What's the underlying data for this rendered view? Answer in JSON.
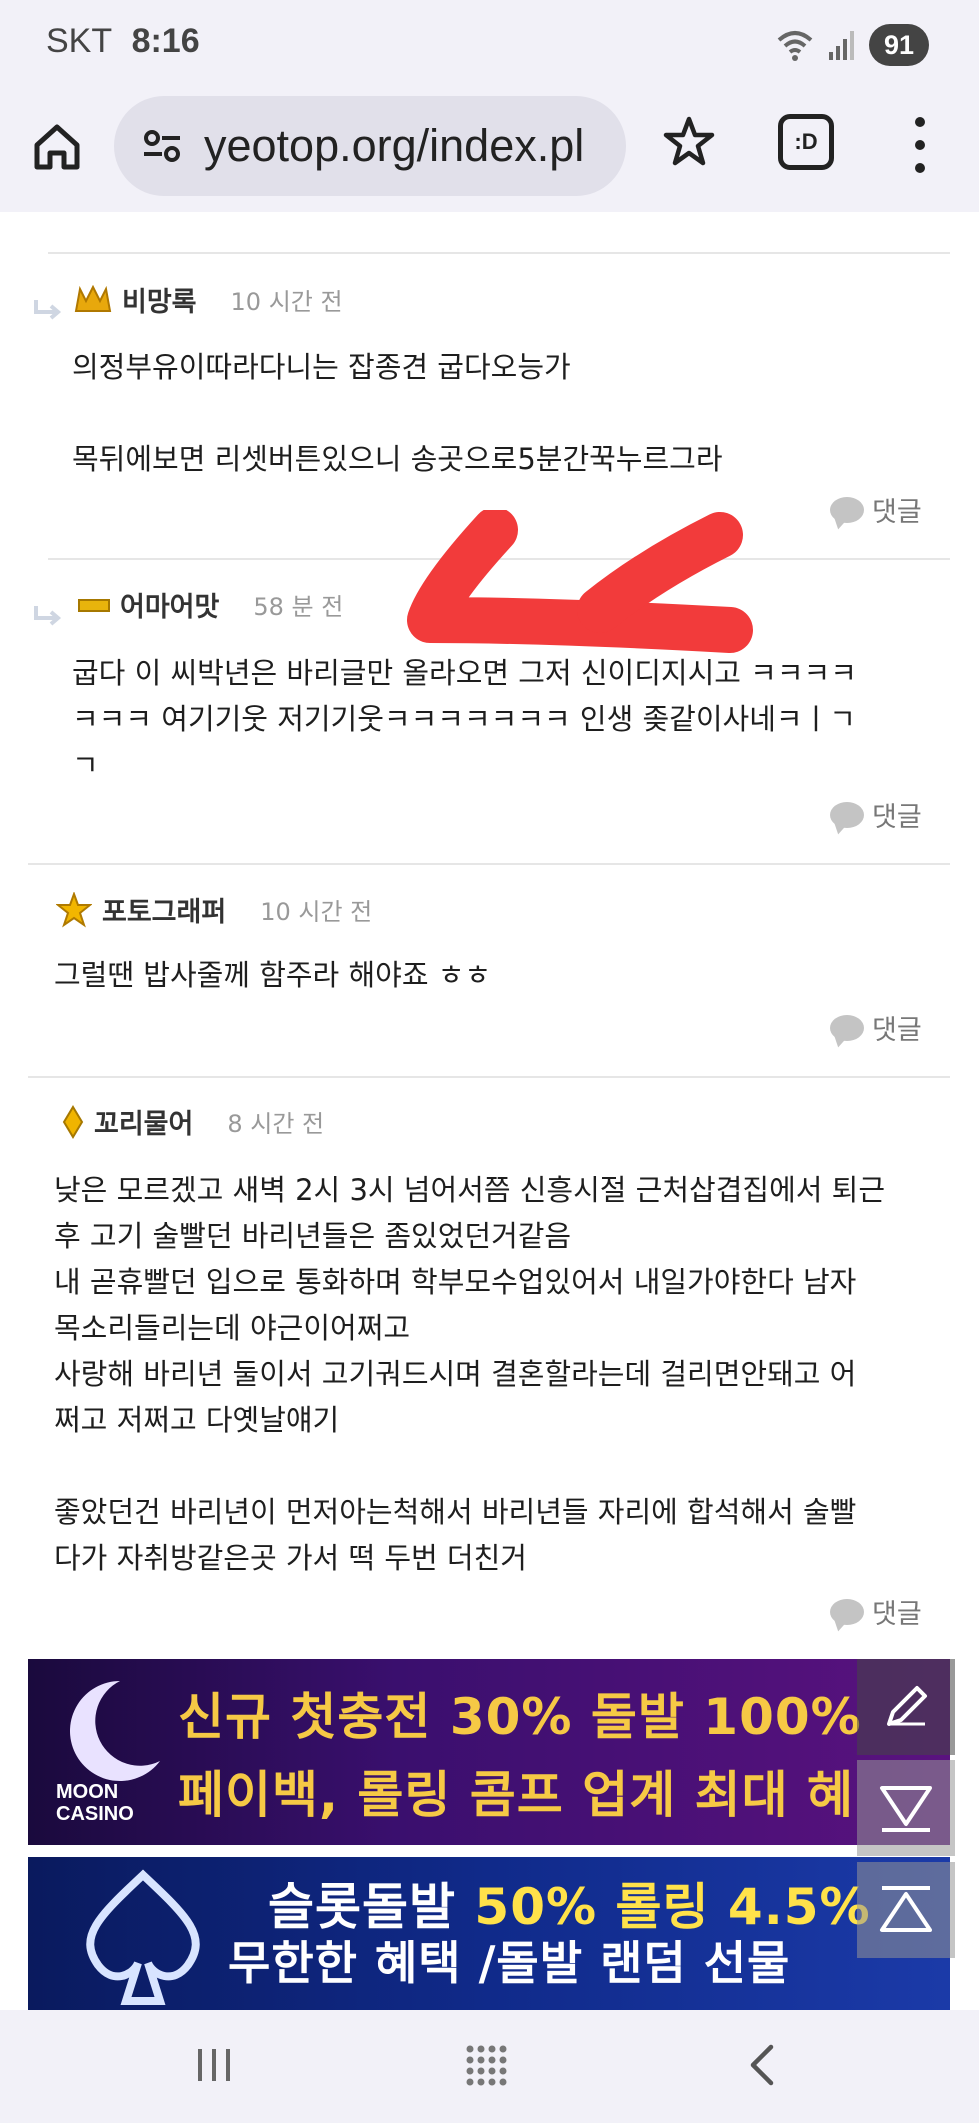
{
  "status_bar": {
    "carrier": "SKT",
    "time": "8:16",
    "battery": "91"
  },
  "browser": {
    "url": "yeotop.org/index.pl",
    "extension_label": ":D"
  },
  "colors": {
    "annotation_arrow": "#f23b3b",
    "banner_gold": "#f6c945",
    "banner_yellow": "#ffe24a"
  },
  "comments": [
    {
      "author": "비망록",
      "time": "10 시간 전",
      "body": "의정부유이따라다니는 잡종견 굽다오능가\n\n목뒤에보면 리셋버튼있으니 송곳으로5분간꾹누르그라",
      "reply_label": "댓글",
      "badge_icon": "crown-gold-icon"
    },
    {
      "author": "어마어맛",
      "time": "58 분 전",
      "body": "굽다 이 씨박년은 바리글만 올라오면 그저 신이디지시고 ㅋㅋㅋㅋ\nㅋㅋㅋ 여기기웃 저기기웃ㅋㅋㅋㅋㅋㅋㅋ 인생 좆같이사네ㅋㅣㄱ\nㄱ",
      "reply_label": "댓글",
      "badge_icon": "gold-bar-icon"
    },
    {
      "author": "포토그래퍼",
      "time": "10 시간 전",
      "body": "그럴땐 밥사줄께 함주라 해야죠 ㅎㅎ",
      "reply_label": "댓글",
      "badge_icon": "gold-star-icon"
    },
    {
      "author": "꼬리물어",
      "time": "8 시간 전",
      "body": "낮은 모르겠고 새벽 2시 3시 넘어서쯤 신흥시절 근처삽겹집에서 퇴근\n후 고기 술빨던 바리년들은 좀있었던거같음\n내 곧휴빨던 입으로 통화하며 학부모수업있어서 내일가야한다 남자\n목소리들리는데 야근이어쩌고\n사랑해 바리년 둘이서 고기궈드시며 결혼할라는데 걸리면안돼고 어\n쩌고 저쩌고 다옛날얘기\n\n좋았던건 바리년이 먼저아는척해서 바리년들 자리에 합석해서 술빨\n다가 자취방같은곳 가서 떡 두번 더친거",
      "reply_label": "댓글",
      "badge_icon": "gold-gem-icon"
    }
  ],
  "banners": [
    {
      "brand": "MOON\nCASINO",
      "line1": "신규 첫충전 30% 돌발 100%",
      "line2": "페이백, 롤링 콤프 업계 최대 혜"
    },
    {
      "line1_a": "슬롯돌발 ",
      "line1_b": "50% 롤링 4.5%",
      "line2": "무한한 혜택 /돌발 랜덤 선물"
    }
  ]
}
